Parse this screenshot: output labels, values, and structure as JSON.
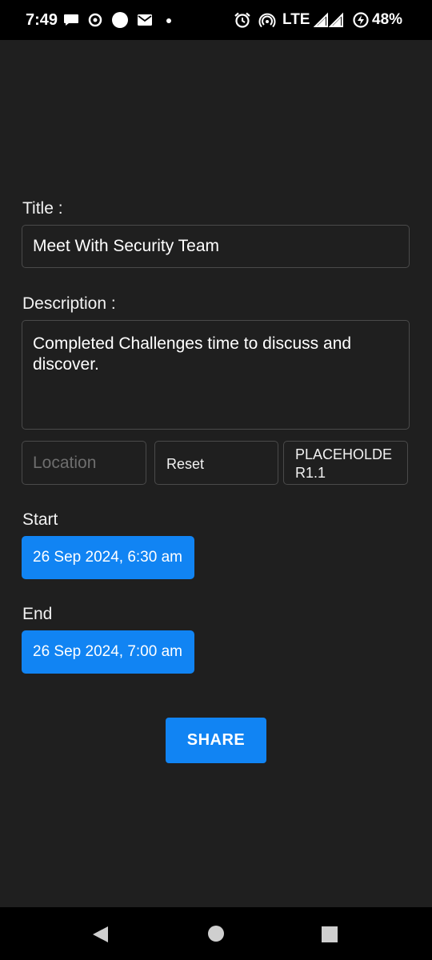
{
  "status_bar": {
    "time": "7:49",
    "network": "LTE",
    "battery": "48%",
    "icons": [
      "message-icon",
      "notification-icon",
      "circle-icon",
      "mail-icon",
      "dot-icon",
      "alarm-icon",
      "hotspot-icon",
      "signal-icon",
      "battery-saver-icon"
    ]
  },
  "form": {
    "title_label": "Title :",
    "title_value": "Meet With Security Team",
    "description_label": "Description :",
    "description_value": "Completed Challenges time to discuss and discover.",
    "location_placeholder": "Location",
    "reset_label": "Reset",
    "placeholder_button_label": "PLACEHOLDE R1.1",
    "start_label": "Start",
    "start_value": "26 Sep 2024, 6:30 am",
    "end_label": "End",
    "end_value": "26 Sep 2024, 7:00 am",
    "share_label": "SHARE"
  },
  "nav_bar": {
    "icons": [
      "back-icon",
      "home-icon",
      "recents-icon"
    ]
  },
  "colors": {
    "background": "#1f1f1f",
    "accent": "#1184f3",
    "bars": "#000000"
  }
}
